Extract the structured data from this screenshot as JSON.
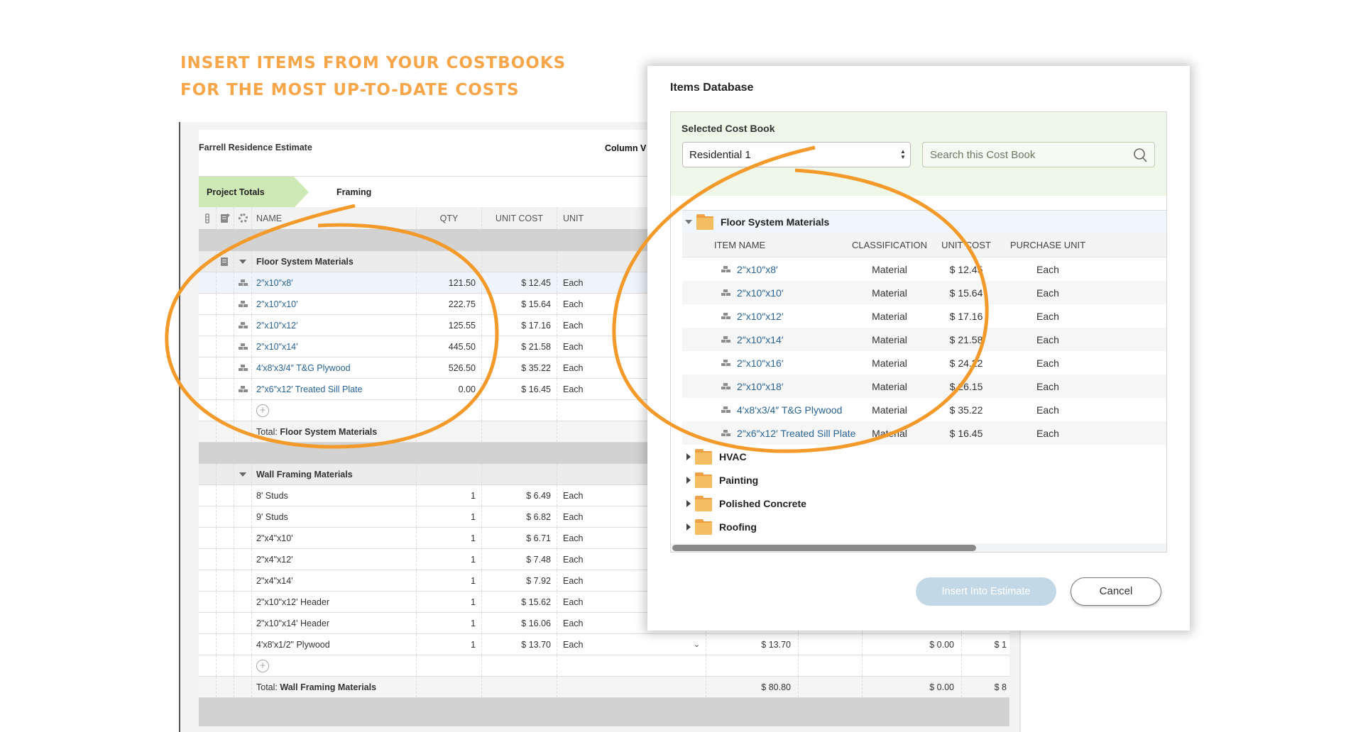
{
  "annotation": {
    "line1": "Insert items from your costbooks",
    "line2": "for the most up-to-date costs",
    "color": "#F7A64A"
  },
  "estimate": {
    "title": "Farrell Residence Estimate",
    "column_view_label": "Column V",
    "tabs": [
      {
        "label": "Project Totals",
        "active": true
      },
      {
        "label": "Framing",
        "active": false
      }
    ],
    "columns": {
      "name": "NAME",
      "qty": "QTY",
      "unit_cost": "UNIT COST",
      "unit": "UNIT"
    },
    "groups": [
      {
        "name": "Floor System Materials",
        "total_label": "Total:",
        "total_name": "Floor System Materials",
        "rows": [
          {
            "name": "2″x10″x8′",
            "qty": "121.50",
            "unit_cost": "$ 12.45",
            "unit": "Each"
          },
          {
            "name": "2″x10″x10′",
            "qty": "222.75",
            "unit_cost": "$ 15.64",
            "unit": "Each"
          },
          {
            "name": "2″x10″x12′",
            "qty": "125.55",
            "unit_cost": "$ 17.16",
            "unit": "Each"
          },
          {
            "name": "2″x10″x14′",
            "qty": "445.50",
            "unit_cost": "$ 21.58",
            "unit": "Each"
          },
          {
            "name": "4′x8′x3/4″ T&G Plywood",
            "qty": "526.50",
            "unit_cost": "$ 35.22",
            "unit": "Each"
          },
          {
            "name": "2″x6″x12′ Treated Sill Plate",
            "qty": "0.00",
            "unit_cost": "$ 16.45",
            "unit": "Each"
          }
        ]
      },
      {
        "name": "Wall Framing Materials",
        "total_label": "Total:",
        "total_name": "Wall Framing Materials",
        "total_values": [
          "$ 80.80",
          "$ 0.00",
          "$ 8"
        ],
        "rows": [
          {
            "name": "8' Studs",
            "qty": "1",
            "unit_cost": "$ 6.49",
            "unit": "Each"
          },
          {
            "name": "9' Studs",
            "qty": "1",
            "unit_cost": "$ 6.82",
            "unit": "Each"
          },
          {
            "name": "2\"x4\"x10'",
            "qty": "1",
            "unit_cost": "$ 6.71",
            "unit": "Each"
          },
          {
            "name": "2\"x4\"x12'",
            "qty": "1",
            "unit_cost": "$ 7.48",
            "unit": "Each"
          },
          {
            "name": "2\"x4\"x14'",
            "qty": "1",
            "unit_cost": "$ 7.92",
            "unit": "Each"
          },
          {
            "name": "2\"x10\"x12' Header",
            "qty": "1",
            "unit_cost": "$ 15.62",
            "unit": "Each"
          },
          {
            "name": "2\"x10\"x14' Header",
            "qty": "1",
            "unit_cost": "$ 16.06",
            "unit": "Each"
          },
          {
            "name": "4'x8'x1/2\" Plywood",
            "qty": "1",
            "unit_cost": "$ 13.70",
            "unit": "Each",
            "extra": [
              "$ 13.70",
              "$ 0.00",
              "$ 1"
            ]
          }
        ]
      }
    ]
  },
  "dialog": {
    "title": "Items Database",
    "cost_book_label": "Selected Cost Book",
    "cost_book_value": "Residential 1",
    "search_placeholder": "Search this Cost Book",
    "open_folder": "Floor System Materials",
    "item_columns": {
      "name": "ITEM NAME",
      "classification": "CLASSIFICATION",
      "unit_cost": "UNIT COST",
      "purchase_unit": "PURCHASE UNIT"
    },
    "items": [
      {
        "name": "2″x10″x8′",
        "classification": "Material",
        "unit_cost": "$ 12.45",
        "purchase_unit": "Each"
      },
      {
        "name": "2″x10″x10′",
        "classification": "Material",
        "unit_cost": "$ 15.64",
        "purchase_unit": "Each"
      },
      {
        "name": "2″x10″x12′",
        "classification": "Material",
        "unit_cost": "$ 17.16",
        "purchase_unit": "Each"
      },
      {
        "name": "2″x10″x14′",
        "classification": "Material",
        "unit_cost": "$ 21.58",
        "purchase_unit": "Each"
      },
      {
        "name": "2″x10″x16′",
        "classification": "Material",
        "unit_cost": "$ 24.22",
        "purchase_unit": "Each"
      },
      {
        "name": "2″x10″x18′",
        "classification": "Material",
        "unit_cost": "$ 26.15",
        "purchase_unit": "Each"
      },
      {
        "name": "4′x8′x3/4″ T&G Plywood",
        "classification": "Material",
        "unit_cost": "$ 35.22",
        "purchase_unit": "Each"
      },
      {
        "name": "2″x6″x12′ Treated Sill Plate",
        "classification": "Material",
        "unit_cost": "$ 16.45",
        "purchase_unit": "Each"
      }
    ],
    "folders": [
      "HVAC",
      "Painting",
      "Polished Concrete",
      "Roofing"
    ],
    "insert_button": "Insert Into Estimate",
    "cancel_button": "Cancel"
  }
}
